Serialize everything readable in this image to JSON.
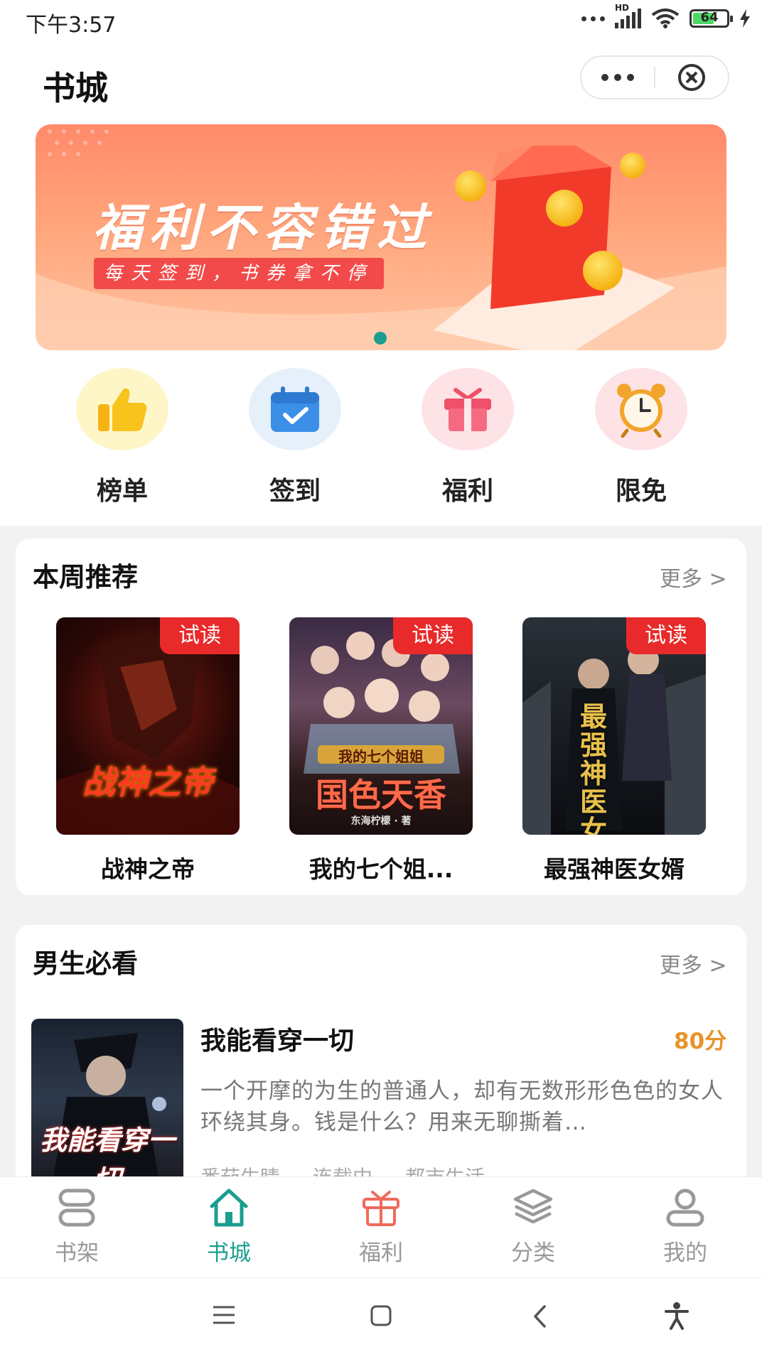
{
  "status": {
    "time": "下午3:57",
    "battery": "64",
    "hd": "HD"
  },
  "header": {
    "title": "书城"
  },
  "banner": {
    "title": "福利不容错过",
    "subtitle": "每天签到，书券拿不停"
  },
  "quick_entries": [
    {
      "label": "榜单",
      "icon": "thumbs-up-icon"
    },
    {
      "label": "签到",
      "icon": "calendar-check-icon"
    },
    {
      "label": "福利",
      "icon": "gift-icon"
    },
    {
      "label": "限免",
      "icon": "alarm-clock-icon"
    }
  ],
  "weekly": {
    "title": "本周推荐",
    "more": "更多 >",
    "books": [
      {
        "title": "战神之帝",
        "tag": "试读",
        "cover_text": "战神之帝"
      },
      {
        "title": "我的七个姐...",
        "tag": "试读",
        "cover_text": "国色天香",
        "cover_sub": "我的七个姐姐",
        "cover_author": "东海柠檬 · 著"
      },
      {
        "title": "最强神医女婿",
        "tag": "试读",
        "cover_text": "最强神医女婿"
      }
    ]
  },
  "boys": {
    "title": "男生必看",
    "more": "更多 >",
    "book": {
      "title": "我能看穿一切",
      "score": "80分",
      "desc": "一个开摩的为生的普通人，却有无数形形色色的女人环绕其身。钱是什么？用来无聊撕着…",
      "cover_text": "我能看穿一切",
      "meta": [
        "番茄生睛",
        "连载中",
        "都市生活"
      ]
    }
  },
  "tabbar": [
    {
      "label": "书架",
      "icon": "bookshelf-icon",
      "active": false
    },
    {
      "label": "书城",
      "icon": "home-icon",
      "active": true
    },
    {
      "label": "福利",
      "icon": "gift-icon",
      "active": false
    },
    {
      "label": "分类",
      "icon": "layers-icon",
      "active": false
    },
    {
      "label": "我的",
      "icon": "user-icon",
      "active": false
    }
  ],
  "colors": {
    "accent": "#1a9e8f",
    "tag_red": "#e82a2a",
    "score": "#e8932a"
  }
}
